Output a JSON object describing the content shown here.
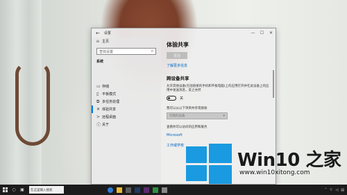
{
  "window": {
    "title": "设置",
    "back_glyph": "←",
    "controls": [
      "—",
      "☐",
      "✕"
    ]
  },
  "nav": {
    "home": "主页",
    "search_placeholder": "查找设置",
    "section": "系统",
    "items": [
      {
        "icon": "storage-icon",
        "glyph": "▭",
        "label": "存储"
      },
      {
        "icon": "tablet-icon",
        "glyph": "▯",
        "label": "平板模式"
      },
      {
        "icon": "multitask-icon",
        "glyph": "⧉",
        "label": "多任务处理"
      },
      {
        "icon": "share-icon",
        "glyph": "✕",
        "label": "体验共享"
      },
      {
        "icon": "remote-icon",
        "glyph": "≻",
        "label": "远程桌面"
      },
      {
        "icon": "info-icon",
        "glyph": "ⓘ",
        "label": "关于"
      }
    ]
  },
  "content": {
    "heading": "体验共享",
    "disabled_button": "更改",
    "learn_more": "了解更多信息",
    "cross_device_heading": "跨设备共享",
    "cross_device_desc": "允许其他设备(包括链接的手机和平板电脑)上的应用打开并在此设备上的应用中发送消息，反之亦然",
    "toggle_state": "关",
    "share_label": "我可以从以下项目共享或接收",
    "share_select": "仅我的设备",
    "stats_label": "查看你可以访问的应用和服务",
    "ms_link": "Microsoft",
    "work_link": "工作或学校"
  },
  "brand": {
    "title": "Win10 之家",
    "url": "www.win10xitong.com",
    "tile_color": "#1a9ae0"
  },
  "taskbar": {
    "search_text": "在这里输入搜索",
    "apps": [
      {
        "icon": "edge-icon",
        "color": "#2f7bd6"
      },
      {
        "icon": "folder-icon",
        "color": "#e8b93a"
      },
      {
        "icon": "store-icon",
        "color": "#5a5a5a"
      },
      {
        "icon": "photoshop-icon",
        "color": "#1f3a66"
      },
      {
        "icon": "premiere-icon",
        "color": "#5b2a6e"
      },
      {
        "icon": "media-icon",
        "color": "#2e8f44"
      },
      {
        "icon": "settings-app-icon",
        "color": "#888888"
      }
    ]
  }
}
